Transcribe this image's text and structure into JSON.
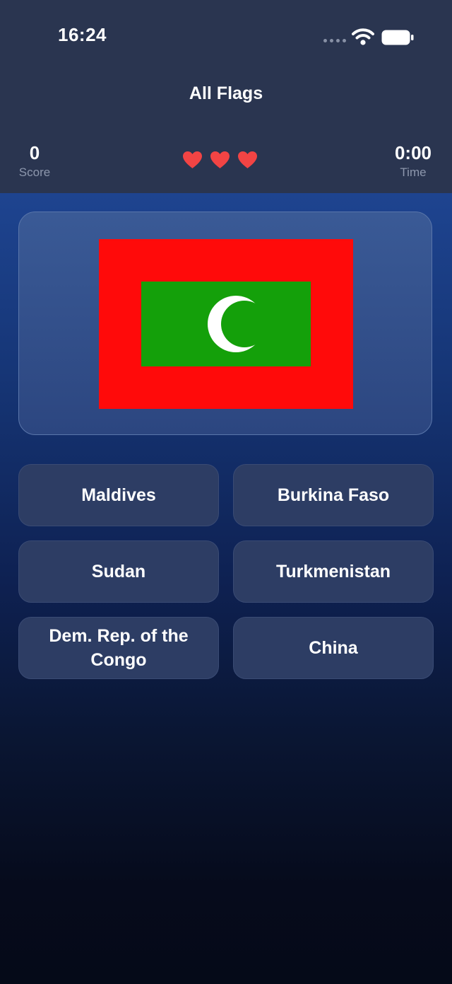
{
  "status_bar": {
    "time": "16:24"
  },
  "header": {
    "title": "All Flags"
  },
  "stats": {
    "score_value": "0",
    "score_label": "Score",
    "time_value": "0:00",
    "time_label": "Time",
    "lives": 3,
    "heart_color": "#f24444"
  },
  "flag": {
    "icon": "maldives-flag",
    "colors": {
      "border": "#ff0a0a",
      "field": "#14a00a",
      "crescent": "#ffffff"
    }
  },
  "answers": [
    {
      "label": "Maldives"
    },
    {
      "label": "Burkina Faso"
    },
    {
      "label": "Sudan"
    },
    {
      "label": "Turkmenistan"
    },
    {
      "label": "Dem. Rep. of the Congo"
    },
    {
      "label": "China"
    }
  ]
}
